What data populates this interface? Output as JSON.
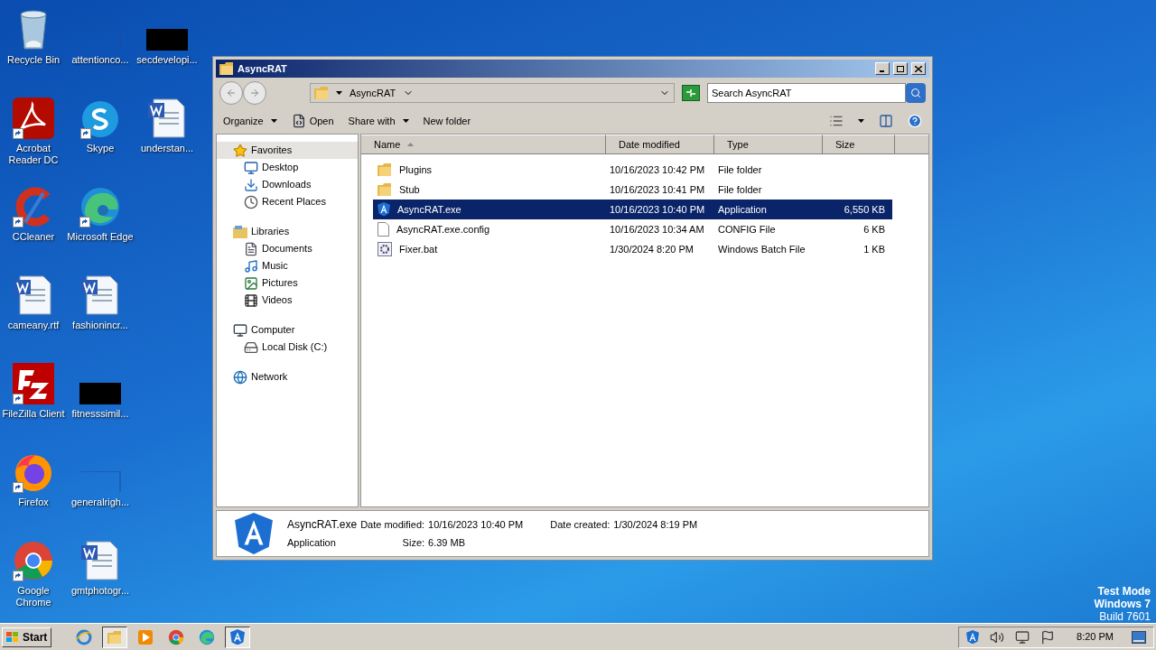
{
  "desktop_columns": [
    [
      {
        "label": "Recycle Bin",
        "kind": "recycle",
        "shortcut": false
      },
      {
        "label": "Acrobat Reader DC",
        "kind": "acrobat",
        "shortcut": true
      },
      {
        "label": "CCleaner",
        "kind": "ccleaner",
        "shortcut": true
      },
      {
        "label": "cameany.rtf",
        "kind": "word",
        "shortcut": false
      },
      {
        "label": "FileZilla Client",
        "kind": "filezilla",
        "shortcut": true
      },
      {
        "label": "Firefox",
        "kind": "firefox",
        "shortcut": true
      },
      {
        "label": "Google Chrome",
        "kind": "chrome",
        "shortcut": true
      }
    ],
    [
      {
        "label": "attentionco...",
        "kind": "blank",
        "shortcut": false
      },
      {
        "label": "Skype",
        "kind": "skype",
        "shortcut": true
      },
      {
        "label": "Microsoft Edge",
        "kind": "edge",
        "shortcut": true
      },
      {
        "label": "fashionincr...",
        "kind": "word",
        "shortcut": false
      },
      {
        "label": "fitnesssimil...",
        "kind": "black",
        "shortcut": false
      },
      {
        "label": "generalrigh...",
        "kind": "blank",
        "shortcut": false
      },
      {
        "label": "gmtphotogr...",
        "kind": "word",
        "shortcut": false
      }
    ],
    [
      {
        "label": "secdevelopi...",
        "kind": "black",
        "shortcut": false
      },
      {
        "label": "understan...",
        "kind": "word",
        "shortcut": false
      }
    ]
  ],
  "window": {
    "title": "AsyncRAT",
    "address": {
      "crumb": "AsyncRAT"
    },
    "search": {
      "placeholder": "Search AsyncRAT"
    },
    "toolbar": [
      {
        "label": "Organize",
        "kind": "menu"
      },
      {
        "label": "Open",
        "kind": "open"
      },
      {
        "label": "Share with",
        "kind": "menu"
      },
      {
        "label": "New folder",
        "kind": "plain"
      }
    ],
    "nav": [
      {
        "label": "Favorites",
        "kind": "star",
        "selected": true,
        "children": [
          {
            "label": "Desktop",
            "kind": "desktop",
            "selected": false
          },
          {
            "label": "Downloads",
            "kind": "downloads",
            "selected": false
          },
          {
            "label": "Recent Places",
            "kind": "recent",
            "selected": false
          }
        ]
      },
      {
        "label": "Libraries",
        "kind": "libraries",
        "selected": false,
        "children": [
          {
            "label": "Documents",
            "kind": "documents",
            "selected": false
          },
          {
            "label": "Music",
            "kind": "music",
            "selected": false
          },
          {
            "label": "Pictures",
            "kind": "pictures",
            "selected": false
          },
          {
            "label": "Videos",
            "kind": "videos",
            "selected": false
          }
        ]
      },
      {
        "label": "Computer",
        "kind": "computer",
        "selected": false,
        "children": [
          {
            "label": "Local Disk (C:)",
            "kind": "disk",
            "selected": false
          }
        ]
      },
      {
        "label": "Network",
        "kind": "network",
        "selected": false
      }
    ],
    "columns": [
      "Name",
      "Date modified",
      "Type",
      "Size"
    ],
    "files": [
      {
        "name": "Plugins",
        "date": "10/16/2023 10:42 PM",
        "type": "File folder",
        "kind": "folder",
        "selected": false
      },
      {
        "name": "Stub",
        "date": "10/16/2023 10:41 PM",
        "type": "File folder",
        "kind": "folder",
        "selected": false
      },
      {
        "name": "AsyncRAT.exe",
        "date": "10/16/2023 10:40 PM",
        "type": "Application",
        "size": "6,550 KB",
        "kind": "app",
        "selected": true
      },
      {
        "name": "AsyncRAT.exe.config",
        "date": "10/16/2023 10:34 AM",
        "type": "CONFIG File",
        "size": "6 KB",
        "kind": "file",
        "selected": false
      },
      {
        "name": "Fixer.bat",
        "date": "1/30/2024 8:20 PM",
        "type": "Windows Batch File",
        "size": "1 KB",
        "kind": "bat",
        "selected": false
      }
    ],
    "details": {
      "name": "AsyncRAT.exe",
      "type": "Application",
      "modified_label": "Date modified:",
      "modified": "10/16/2023 10:40 PM",
      "created_label": "Date created:",
      "created": "1/30/2024 8:19 PM",
      "size_label": "Size:",
      "size": "6.39 MB"
    }
  },
  "watermark_os": [
    "Test Mode",
    "Windows 7",
    "Build 7601"
  ],
  "taskbar": {
    "start": "Start",
    "apps": [
      {
        "kind": "ie",
        "selected": false
      },
      {
        "kind": "explorer",
        "selected": true
      },
      {
        "kind": "media",
        "selected": false
      },
      {
        "kind": "chrome",
        "selected": false
      },
      {
        "kind": "edge",
        "selected": false
      },
      {
        "kind": "async",
        "selected": true
      }
    ],
    "clock": "8:20 PM"
  }
}
